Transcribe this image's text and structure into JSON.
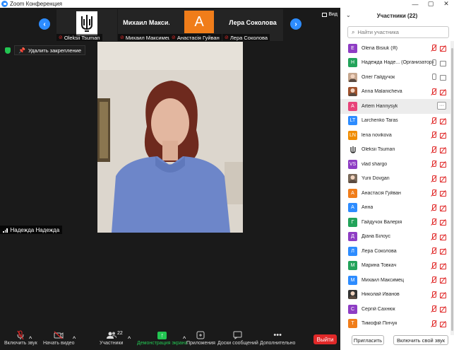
{
  "window": {
    "title": "Zoom Конференция",
    "controls": [
      "—",
      "▢",
      "✕"
    ]
  },
  "strip": {
    "prev_arrow": "‹",
    "next_arrow": "›",
    "thumbs": [
      {
        "label": "Oleksii Tsuman",
        "type": "emblem"
      },
      {
        "label": "Михаил Максимец",
        "center_name": "Михаил  Макси...",
        "type": "name"
      },
      {
        "label": "Анастасія Гуйван",
        "avatar_letter": "А",
        "avatar_color": "#f07d1a",
        "type": "avatar"
      },
      {
        "label": "Лера Соколова",
        "center_name": "Лера Соколова",
        "type": "name"
      }
    ],
    "view_label": "Вид"
  },
  "unpin_label": "Удалить закрепление",
  "speaker_name": "Надежда Надежда",
  "toolbar": {
    "unmute": "Включить звук",
    "start_video": "Начать видео",
    "participants": "Участники",
    "participants_count": "22",
    "share": "Демонстрация экрана",
    "apps": "Приложения",
    "chat": "Доски сообщений",
    "more": "Дополнительно",
    "leave": "Выйти"
  },
  "panel": {
    "title": "Участники (22)",
    "search_placeholder": "Найти участника",
    "invite": "Пригласить",
    "unmute_me": "Включить свой звук",
    "participants": [
      {
        "name": "Olena Bisiuk (Я)",
        "initials": "E",
        "color": "#8e3dc4",
        "mic": "muted",
        "cam": "off"
      },
      {
        "name": "Надежда Наде...  (Организатор)",
        "initials": "Н",
        "color": "#22a35a",
        "mic": "on",
        "cam": "on"
      },
      {
        "name": "Олег Гайдучок",
        "initials": "",
        "color": "#c6a78f",
        "mic": "on",
        "cam": "on",
        "photo": true
      },
      {
        "name": "Anna Malanicheva",
        "initials": "",
        "color": "#a0522d",
        "mic": "muted",
        "cam": "off",
        "photo": true
      },
      {
        "name": "Artem Hannysyk",
        "initials": "A",
        "color": "#e8437a",
        "mic": "none",
        "cam": "none",
        "hover": true
      },
      {
        "name": "Larchenko Taras",
        "initials": "LT",
        "color": "#2d8cff",
        "mic": "muted",
        "cam": "off"
      },
      {
        "name": "lena novikova",
        "initials": "LN",
        "color": "#f08c00",
        "mic": "muted",
        "cam": "off"
      },
      {
        "name": "Oleksii Tsuman",
        "initials": "",
        "color": "#ffffff",
        "mic": "muted",
        "cam": "off",
        "emblem": true
      },
      {
        "name": "vlad shargo",
        "initials": "VS",
        "color": "#8e3dc4",
        "mic": "muted",
        "cam": "off"
      },
      {
        "name": "Yurii Dovgan",
        "initials": "",
        "color": "#7a6a5a",
        "mic": "muted",
        "cam": "off",
        "photo": true
      },
      {
        "name": "Анастасія Гуйван",
        "initials": "А",
        "color": "#f07d1a",
        "mic": "muted",
        "cam": "off"
      },
      {
        "name": "Анна",
        "initials": "А",
        "color": "#2d8cff",
        "mic": "muted",
        "cam": "off"
      },
      {
        "name": "Гайдучок Валерія",
        "initials": "Г",
        "color": "#22a35a",
        "mic": "muted",
        "cam": "off"
      },
      {
        "name": "Діана Білоус",
        "initials": "Д",
        "color": "#8e3dc4",
        "mic": "muted",
        "cam": "off"
      },
      {
        "name": "Лера Соколова",
        "initials": "Л",
        "color": "#2d8cff",
        "mic": "muted",
        "cam": "off"
      },
      {
        "name": "Марина Товкач",
        "initials": "М",
        "color": "#22a35a",
        "mic": "muted",
        "cam": "off"
      },
      {
        "name": "Михаил Максимец",
        "initials": "М",
        "color": "#2d8cff",
        "mic": "muted",
        "cam": "off"
      },
      {
        "name": "Николай Иванов",
        "initials": "",
        "color": "#333333",
        "mic": "muted",
        "cam": "off",
        "photo": true
      },
      {
        "name": "Сергій Сахнюк",
        "initials": "С",
        "color": "#8e3dc4",
        "mic": "muted",
        "cam": "off"
      },
      {
        "name": "Тимофій Пiнчук",
        "initials": "Т",
        "color": "#f07d1a",
        "mic": "muted",
        "cam": "off"
      }
    ]
  },
  "colors": {
    "accent": "#2d8cff",
    "leave": "#e02828",
    "share": "#23c552",
    "muted": "#e02828"
  }
}
